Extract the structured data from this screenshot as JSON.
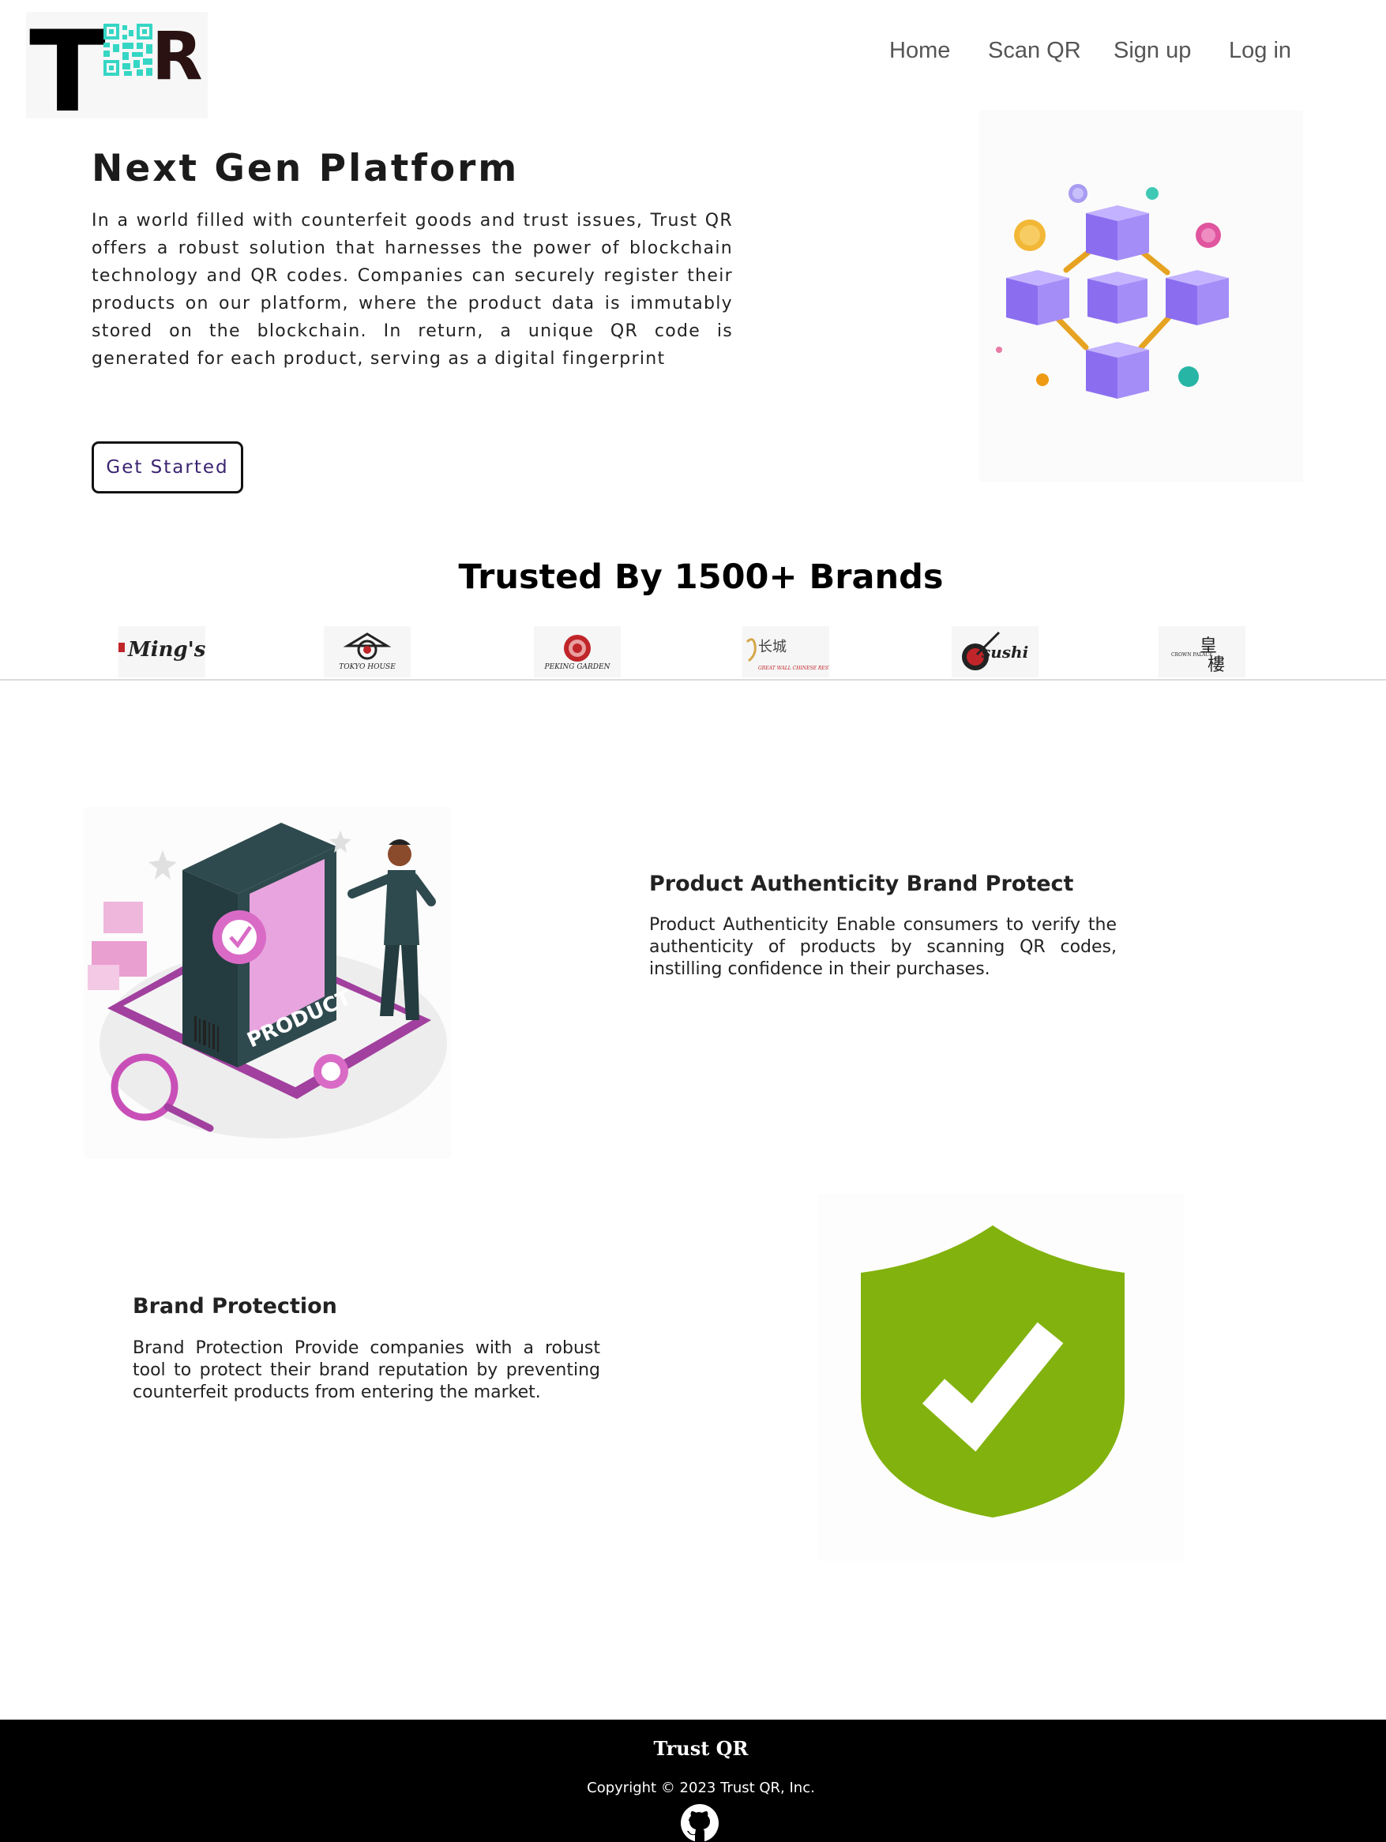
{
  "header": {
    "logo_text": "TQR",
    "nav": [
      "Home",
      "Scan QR",
      "Sign up",
      "Log in"
    ]
  },
  "hero": {
    "title": "Next Gen Platform",
    "description": "In a world filled with counterfeit goods and trust issues, Trust QR offers a robust solution that harnesses the power of blockchain technology and QR codes. Companies can securely register their products on our platform, where the product data is immutably stored on the blockchain. In return, a unique QR code is generated for each product, serving as a digital fingerprint",
    "cta_label": "Get Started",
    "image_icon": "blockchain-cubes-illustration"
  },
  "trusted": {
    "title": "Trusted By 1500+ Brands",
    "brands": [
      "Ming's",
      "TOKYO HOUSE",
      "PEKING GARDEN",
      "GREAT WALL CHINESE RESTAURANT",
      "sushi",
      "CROWN PALACE"
    ]
  },
  "features": [
    {
      "title": "Product Authenticity Brand Protect",
      "text": "Product Authenticity Enable consumers to verify the authenticity of products by scanning QR codes, instilling confidence in their purchases.",
      "image_icon": "product-verification-illustration",
      "image_label": "PRODUCT"
    },
    {
      "title": "Brand Protection",
      "text": "Brand Protection Provide companies with a robust tool to protect their brand reputation by preventing counterfeit products from entering the market.",
      "image_icon": "shield-check-icon"
    }
  ],
  "footer": {
    "brand": "Trust QR",
    "copyright": "Copyright © 2023 Trust QR, Inc.",
    "icon": "github-icon"
  },
  "colors": {
    "accent_teal": "#35d6c4",
    "cube_purple": "#8b6ef0",
    "shield_green": "#82b20d",
    "button_text": "#3b2470",
    "footer_bg": "#000000"
  }
}
